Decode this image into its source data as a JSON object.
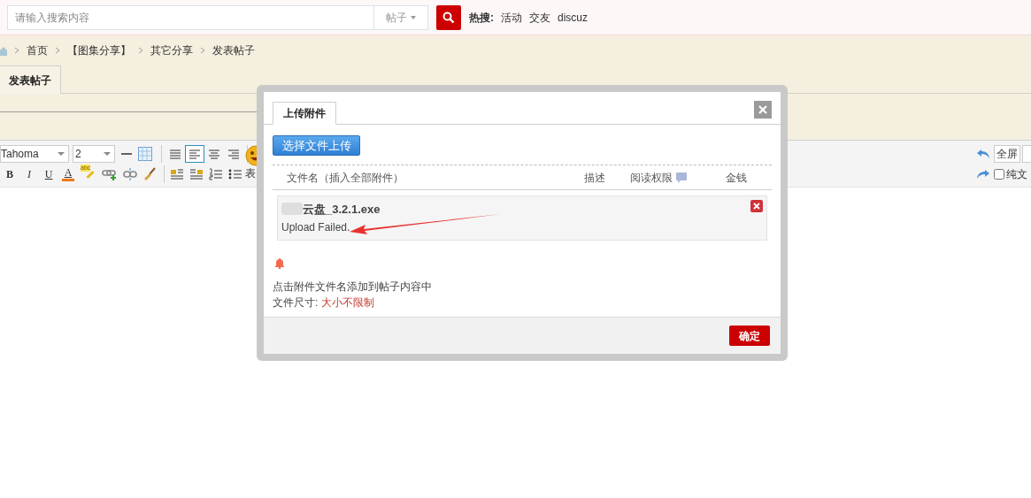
{
  "search": {
    "placeholder": "请输入搜索内容",
    "scope": "帖子"
  },
  "hot_search": {
    "label": "热搜:",
    "terms": [
      "活动",
      "交友",
      "discuz"
    ]
  },
  "breadcrumb": [
    "首页",
    "【图集分享】",
    "其它分享",
    "发表帖子"
  ],
  "tabs": [
    {
      "label": "发表帖子",
      "selected": true
    }
  ],
  "editor_toolbar": {
    "font": "Tahoma",
    "size": "2",
    "align_buttons": [
      {
        "kind": "justify",
        "selected": false
      },
      {
        "kind": "left",
        "selected": true
      },
      {
        "kind": "center",
        "selected": false
      },
      {
        "kind": "right",
        "selected": false
      }
    ],
    "format_buttons": [
      {
        "kind": "text",
        "label": "B"
      },
      {
        "kind": "text",
        "label": "I"
      },
      {
        "kind": "text",
        "label": "U"
      },
      {
        "kind": "color",
        "label": "A"
      },
      {
        "kind": "highlight",
        "label": "abc"
      },
      {
        "kind": "link"
      },
      {
        "kind": "unlink"
      },
      {
        "kind": "brush"
      }
    ],
    "emoji_label": "表",
    "fullscreen": "全屏",
    "plain_text": {
      "label": "纯文",
      "checked": false
    }
  },
  "dialog": {
    "tab": "上传附件",
    "upload_button": "选择文件上传",
    "columns": [
      "文件名（插入全部附件）",
      "描述",
      "阅读权限",
      "金钱"
    ],
    "files": [
      {
        "name": "云盘_3.2.1.exe",
        "status": "Upload Failed."
      }
    ],
    "hint": "点击附件文件名添加到帖子内容中",
    "size_label": "文件尺寸:",
    "size_value": "大小不限制",
    "confirm": "确定"
  }
}
